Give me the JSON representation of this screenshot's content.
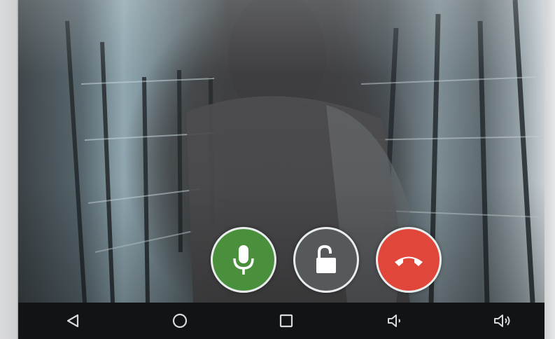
{
  "call_controls": {
    "mic_color": "#4a8f3c",
    "unlock_color": "#55595c",
    "hangup_color": "#e0463a"
  },
  "icons": {
    "mic": "microphone-icon",
    "unlock": "unlock-padlock-icon",
    "hangup": "phone-hangup-icon",
    "back": "back-triangle-icon",
    "home": "home-circle-icon",
    "recents": "recents-square-icon",
    "volume_down": "volume-down-icon",
    "volume_up": "volume-up-icon"
  }
}
